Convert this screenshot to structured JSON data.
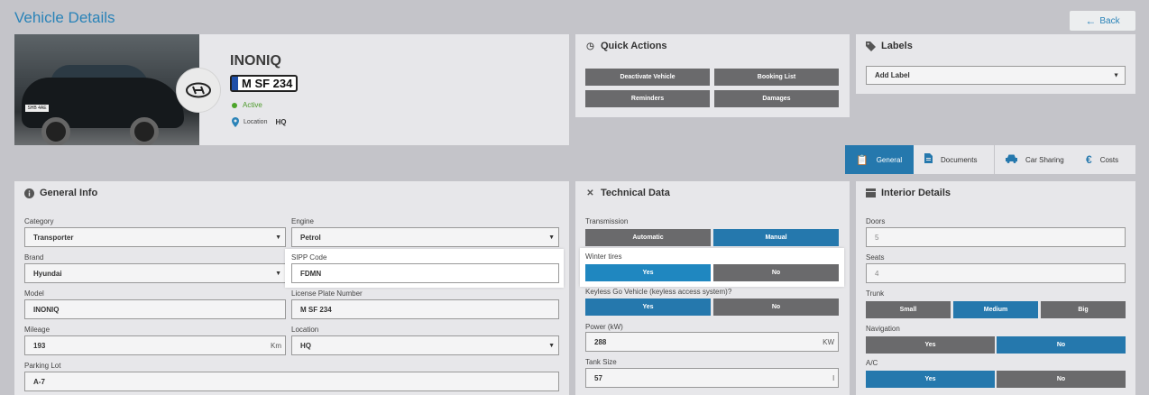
{
  "page": {
    "title": "Vehicle Details",
    "back_label": "Back"
  },
  "vehicle": {
    "model": "INONIQ",
    "plate": "M SF 234",
    "status": "Active",
    "location_label": "Location",
    "location_value": "HQ",
    "photo_plate_text": "SHB 4AE"
  },
  "quick_actions": {
    "title": "Quick Actions",
    "buttons": [
      "Deactivate Vehicle",
      "Booking List",
      "Reminders",
      "Damages"
    ]
  },
  "labels": {
    "title": "Labels",
    "select_value": "Add Label"
  },
  "tabs": [
    {
      "label": "General",
      "icon": "clipboard-icon",
      "active": true
    },
    {
      "label": "Documents",
      "icon": "document-icon",
      "active": false
    },
    {
      "label": "Car Sharing",
      "icon": "car-icon",
      "active": false
    },
    {
      "label": "Costs",
      "icon": "euro-icon",
      "active": false
    }
  ],
  "general_info": {
    "title": "General Info",
    "category": {
      "label": "Category",
      "value": "Transporter"
    },
    "engine": {
      "label": "Engine",
      "value": "Petrol"
    },
    "brand": {
      "label": "Brand",
      "value": "Hyundai"
    },
    "sipp": {
      "label": "SIPP Code",
      "value": "FDMN"
    },
    "model": {
      "label": "Model",
      "value": "INONIQ"
    },
    "license": {
      "label": "License Plate Number",
      "value": "M SF 234"
    },
    "mileage": {
      "label": "Mileage",
      "value": "193",
      "unit": "Km"
    },
    "location": {
      "label": "Location",
      "value": "HQ"
    },
    "parking": {
      "label": "Parking Lot",
      "value": "A-7"
    }
  },
  "technical": {
    "title": "Technical Data",
    "transmission": {
      "label": "Transmission",
      "options": [
        "Automatic",
        "Manual"
      ],
      "selected": "Manual"
    },
    "winter": {
      "label": "Winter tires",
      "options": [
        "Yes",
        "No"
      ],
      "selected": "Yes"
    },
    "keyless": {
      "label": "Keyless Go Vehicle (keyless access system)?",
      "options": [
        "Yes",
        "No"
      ],
      "selected": "Yes"
    },
    "power": {
      "label": "Power (kW)",
      "value": "288",
      "unit": "KW"
    },
    "tank": {
      "label": "Tank Size",
      "value": "57",
      "unit": "l"
    }
  },
  "interior": {
    "title": "Interior Details",
    "doors": {
      "label": "Doors",
      "value": "5"
    },
    "seats": {
      "label": "Seats",
      "value": "4"
    },
    "trunk": {
      "label": "Trunk",
      "options": [
        "Small",
        "Medium",
        "Big"
      ],
      "selected": "Medium"
    },
    "navigation": {
      "label": "Navigation",
      "options": [
        "Yes",
        "No"
      ],
      "selected": "No"
    },
    "ac": {
      "label": "A/C",
      "options": [
        "Yes",
        "No"
      ],
      "selected": "Yes"
    }
  },
  "colors": {
    "accent": "#2578ad",
    "active_status": "#4ca42a",
    "button_gray": "#6a6a6c",
    "background": "#c4c4c9"
  }
}
